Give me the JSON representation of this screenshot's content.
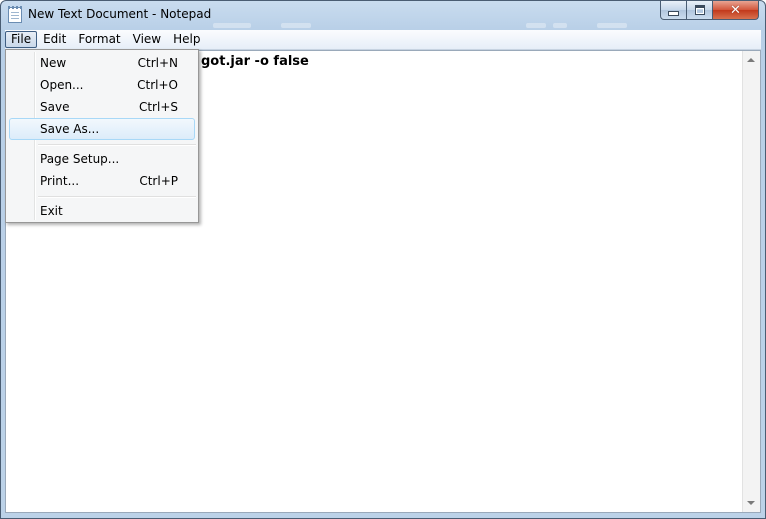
{
  "window": {
    "title": "New Text Document - Notepad",
    "close_glyph": "✕"
  },
  "menubar": {
    "items": [
      {
        "label": "File",
        "active": true
      },
      {
        "label": "Edit"
      },
      {
        "label": "Format"
      },
      {
        "label": "View"
      },
      {
        "label": "Help"
      }
    ]
  },
  "editor": {
    "visible_text": "got.jar -o false"
  },
  "file_menu": {
    "items": [
      {
        "label": "New",
        "shortcut": "Ctrl+N"
      },
      {
        "label": "Open...",
        "shortcut": "Ctrl+O"
      },
      {
        "label": "Save",
        "shortcut": "Ctrl+S"
      },
      {
        "label": "Save As...",
        "shortcut": "",
        "highlighted": true
      },
      {
        "label": "Page Setup...",
        "shortcut": ""
      },
      {
        "label": "Print...",
        "shortcut": "Ctrl+P"
      },
      {
        "label": "Exit",
        "shortcut": ""
      }
    ]
  },
  "colors": {
    "hover_border": "#a8d8f7",
    "close_button": "#c2391b",
    "title_bar": "#c9dcef"
  }
}
